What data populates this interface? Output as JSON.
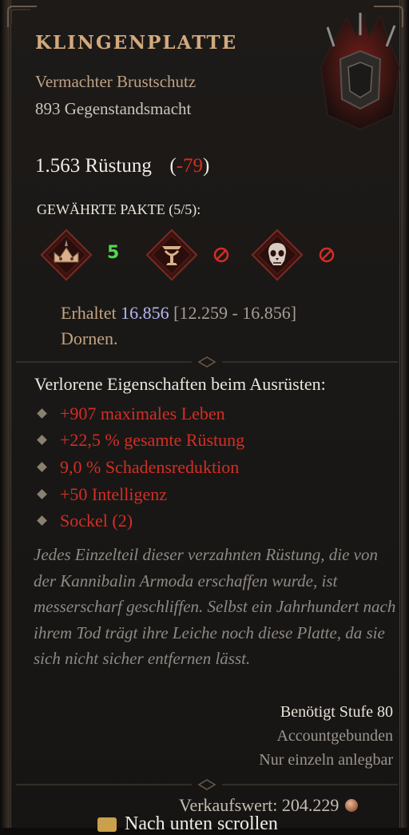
{
  "item": {
    "name": "KLINGENPLATTE",
    "type": "Vermachter Brustschutz",
    "power": "893 Gegenstandsmacht",
    "armor_value": "1.563 Rüstung",
    "armor_open": "(",
    "armor_diff": "-79",
    "armor_close": ")"
  },
  "pacts": {
    "label": "GEWÄHRTE PAKTE (5/5):",
    "icons": [
      "crown-pact-icon",
      "chalice-pact-icon",
      "skull-pact-icon"
    ],
    "count": "5"
  },
  "thorns": {
    "prefix": "Erhaltet ",
    "value": "16.856",
    "range": " [12.259 - 16.856]",
    "suffix": " Dornen."
  },
  "lost": {
    "heading": "Verlorene Eigenschaften beim Ausrüsten:",
    "affixes": [
      "+907 maximales Leben",
      "+22,5 % gesamte Rüstung",
      "9,0 % Schadensreduktion",
      "+50 Intelligenz",
      "Sockel (2)"
    ]
  },
  "flavor": "Jedes Einzelteil dieser verzahnten Rüstung, die von der Kannibalin Armoda erschaffen wurde, ist messerscharf geschliffen. Selbst ein Jahrhundert nach ihrem Tod trägt ihre Leiche noch diese Platte, da sie sich nicht sicher entfernen lässt.",
  "requirements": {
    "level": "Benötigt Stufe 80",
    "bound": "Accountgebunden",
    "equip": "Nur einzeln anlegbar"
  },
  "footer": {
    "sell_value": "Verkaufswert: 204.229",
    "scroll": "Nach unten scrollen"
  },
  "colors": {
    "title": "#d2a97d",
    "negative": "#d22e25",
    "pact_count": "#4fd84f",
    "magic_value": "#b4b8f2"
  }
}
